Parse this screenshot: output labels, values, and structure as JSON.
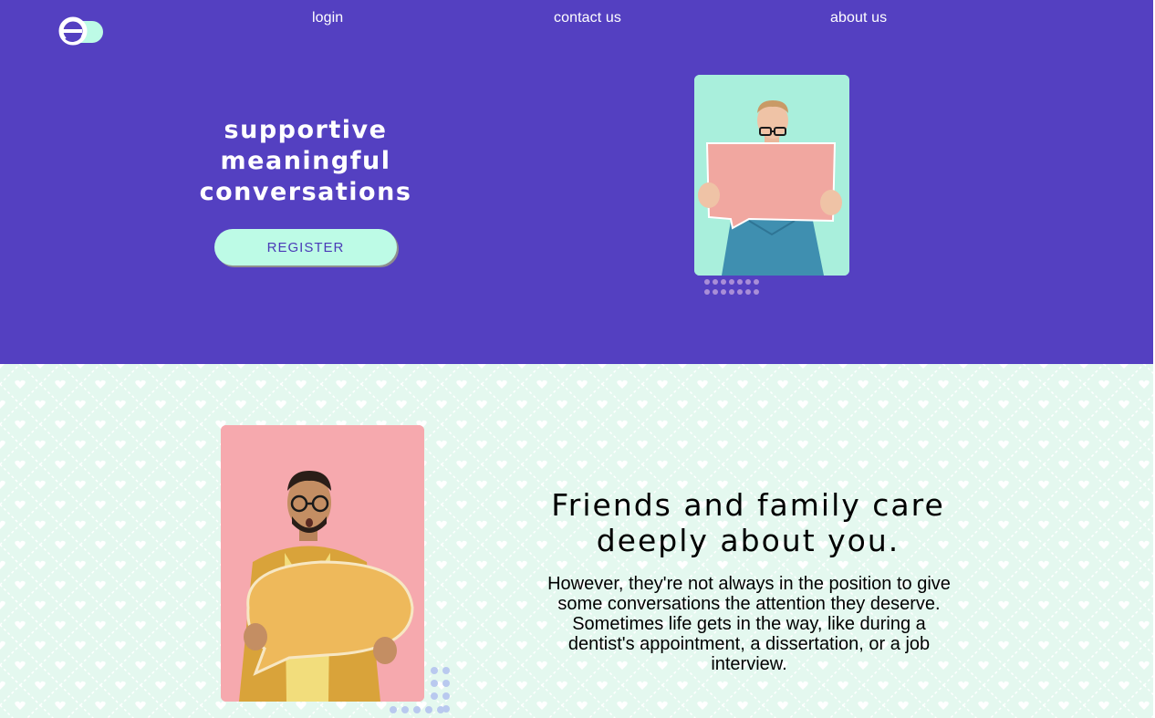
{
  "nav": {
    "logo_letter": "e",
    "links": [
      "login",
      "contact us",
      "about us"
    ]
  },
  "hero": {
    "tagline": [
      "supportive",
      "meaningful",
      "conversations"
    ],
    "register_label": "REGISTER",
    "image": "man-holding-speech-bubble-sign"
  },
  "section2": {
    "headline": [
      "Friends and family care",
      "deeply about you."
    ],
    "paragraph1": "However, they're not always in the position to give some conversations the attention they deserve.",
    "paragraph2": "Sometimes life gets in the way, like during a dentist's appointment, a dissertation, or a job interview.",
    "image": "man-holding-yellow-speech-bubble"
  },
  "colors": {
    "hero_bg": "#5440c1",
    "section_bg": "#e4f8ef",
    "button_bg": "#bdfbe6",
    "button_text": "#4a3ab7"
  }
}
